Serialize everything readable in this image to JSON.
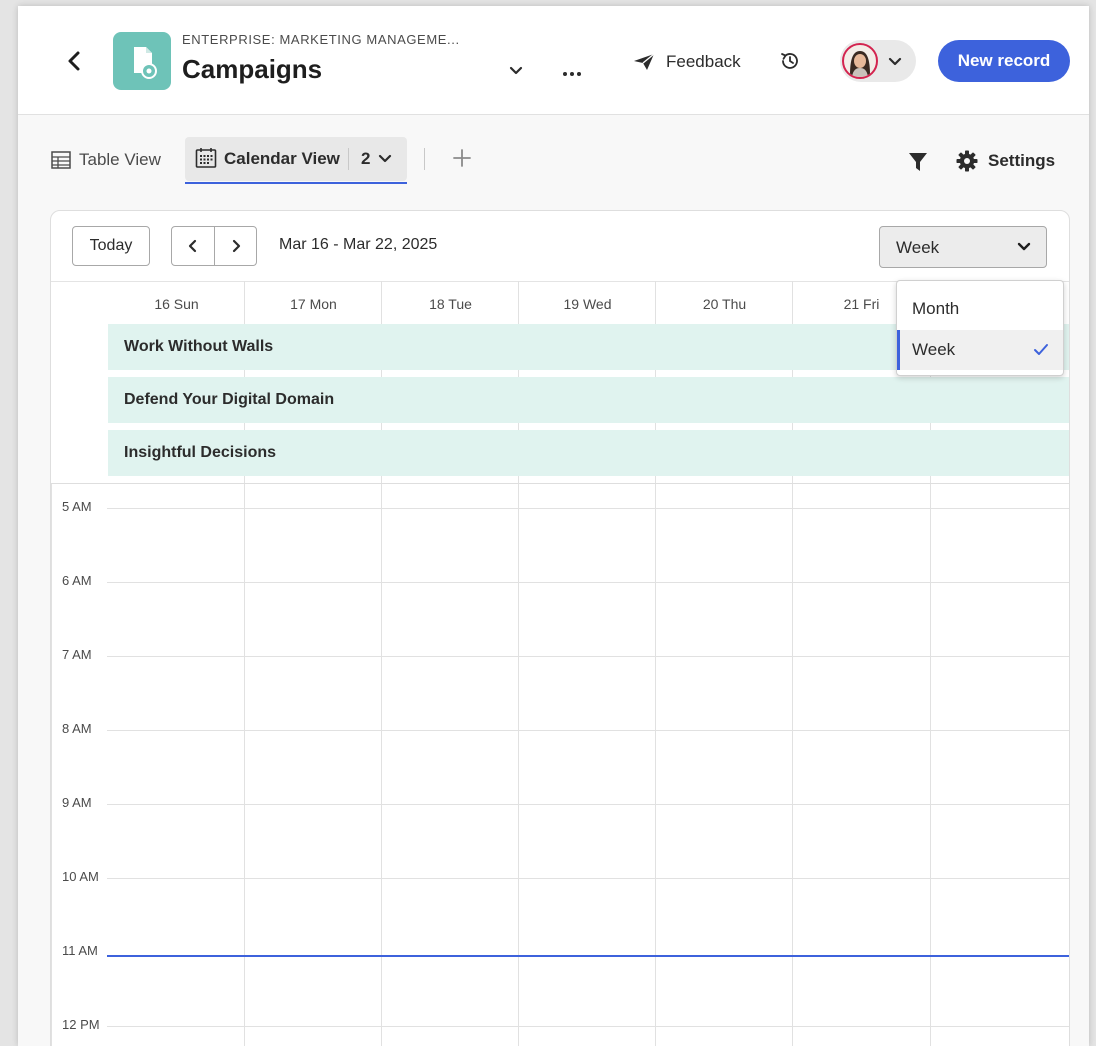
{
  "header": {
    "subtitle": "ENTERPRISE: MARKETING MANAGEME...",
    "title": "Campaigns",
    "feedback_label": "Feedback",
    "new_record_label": "New record"
  },
  "views": {
    "table_view_label": "Table View",
    "calendar_view_label": "Calendar View",
    "calendar_view_count": "2",
    "settings_label": "Settings"
  },
  "calendar": {
    "today_label": "Today",
    "date_range": "Mar 16 - Mar 22, 2025",
    "view_mode": "Week",
    "days": [
      "16 Sun",
      "17 Mon",
      "18 Tue",
      "19 Wed",
      "20 Thu",
      "21 Fri"
    ],
    "all_day_events": [
      "Work Without Walls",
      "Defend Your Digital Domain",
      "Insightful Decisions"
    ],
    "hours": [
      "5 AM",
      "6 AM",
      "7 AM",
      "8 AM",
      "9 AM",
      "10 AM",
      "11 AM",
      "12 PM"
    ]
  },
  "view_mode_dropdown": {
    "options": [
      "Month",
      "Week"
    ],
    "selected": "Week"
  },
  "colors": {
    "accent": "#3d62dc",
    "event_bg": "#e0f3ef",
    "app_icon": "#6ec3b8"
  }
}
